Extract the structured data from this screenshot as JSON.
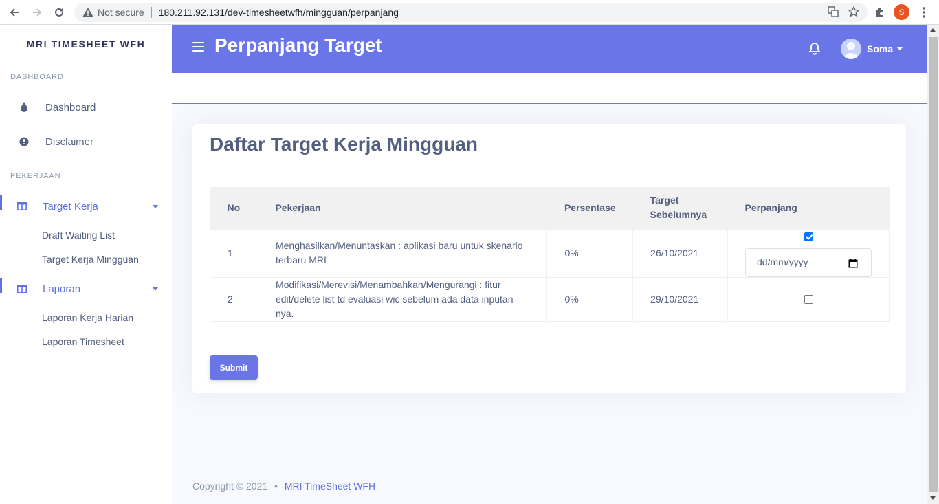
{
  "browser": {
    "security_label": "Not secure",
    "url": "180.211.92.131/dev-timesheetwfh/mingguan/perpanjang",
    "profile_initial": "S"
  },
  "sidebar": {
    "brand": "MRI TIMESHEET WFH",
    "sections": [
      {
        "heading": "DASHBOARD"
      },
      {
        "heading": "PEKERJAAN"
      }
    ],
    "items": [
      {
        "label": "Dashboard",
        "icon": "droplet-icon"
      },
      {
        "label": "Disclaimer",
        "icon": "info-circle-icon"
      },
      {
        "label": "Target Kerja",
        "icon": "table-columns-icon",
        "children": [
          "Draft Waiting List",
          "Target Kerja Mingguan"
        ]
      },
      {
        "label": "Laporan",
        "icon": "table-columns-icon",
        "children": [
          "Laporan Kerja Harian",
          "Laporan Timesheet"
        ]
      }
    ]
  },
  "header": {
    "title": "Perpanjang Target",
    "user_name": "Soma"
  },
  "card": {
    "title": "Daftar Target Kerja Mingguan",
    "columns": [
      "No",
      "Pekerjaan",
      "Persentase",
      "Target Sebelumnya",
      "Perpanjang"
    ],
    "rows": [
      {
        "no": "1",
        "job": "Menghasilkan/Menuntaskan : aplikasi baru untuk skenario terbaru MRI",
        "pct": "0%",
        "target": "26/10/2021",
        "extend_checked": true,
        "date_placeholder": "dd/mm/yyyy"
      },
      {
        "no": "2",
        "job": "Modifikasi/Merevisi/Menambahkan/Mengurangi : fitur edit/delete list td evaluasi wic sebelum ada data inputan nya.",
        "pct": "0%",
        "target": "29/10/2021",
        "extend_checked": false
      }
    ],
    "submit_label": "Submit"
  },
  "footer": {
    "copyright": "Copyright © 2021",
    "separator": "•",
    "link": "MRI TimeSheet WFH"
  },
  "colors": {
    "primary": "#5e72e4",
    "topbar": "#6a76e8",
    "text": "#525f7f",
    "muted": "#8898aa"
  }
}
